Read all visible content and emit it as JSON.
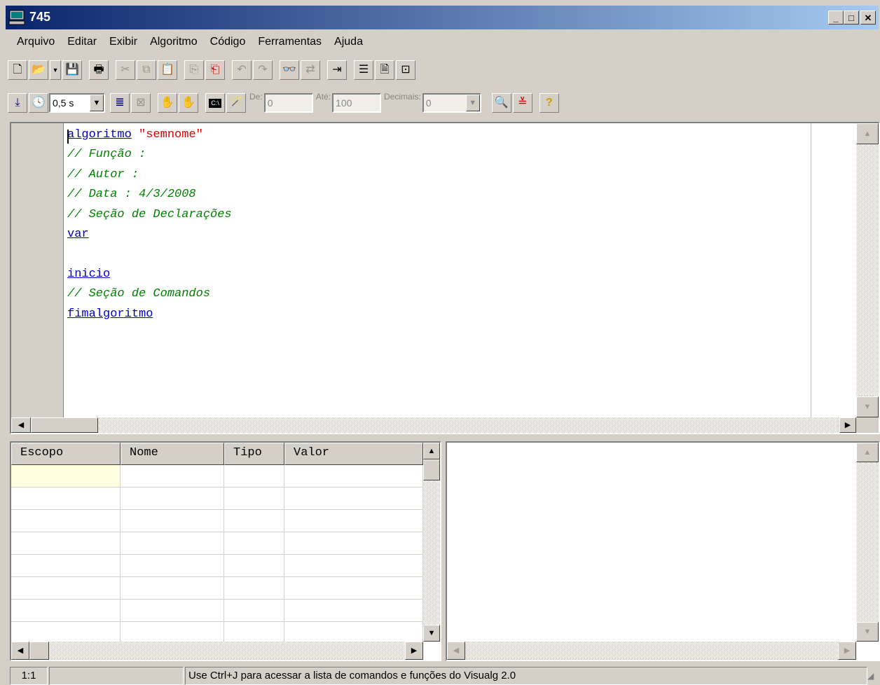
{
  "window": {
    "title": "745"
  },
  "menu": [
    "Arquivo",
    "Editar",
    "Exibir",
    "Algoritmo",
    "Código",
    "Ferramentas",
    "Ajuda"
  ],
  "toolbar2": {
    "speed_value": "0,5 s",
    "de_label": "De:",
    "de_value": "0",
    "ate_label": "Até:",
    "ate_value": "100",
    "decimais_label": "Decimais:",
    "decimais_value": "0"
  },
  "editor": {
    "lines": [
      [
        {
          "t": "algoritmo",
          "c": "kw"
        },
        {
          "t": " "
        },
        {
          "t": "\"semnome\"",
          "c": "str"
        }
      ],
      [
        {
          "t": "// Função :",
          "c": "cm"
        }
      ],
      [
        {
          "t": "// Autor :",
          "c": "cm"
        }
      ],
      [
        {
          "t": "// Data : 4/3/2008",
          "c": "cm"
        }
      ],
      [
        {
          "t": "// Seção de Declarações",
          "c": "cm"
        }
      ],
      [
        {
          "t": "var",
          "c": "kw"
        }
      ],
      [],
      [
        {
          "t": "inicio",
          "c": "kw"
        }
      ],
      [
        {
          "t": "// Seção de Comandos",
          "c": "cm"
        }
      ],
      [
        {
          "t": "fimalgoritmo",
          "c": "kw"
        }
      ]
    ]
  },
  "variables": {
    "columns": [
      "Escopo",
      "Nome",
      "Tipo",
      "Valor"
    ],
    "row_count": 8
  },
  "status": {
    "position": "1:1",
    "middle": "",
    "message": "Use Ctrl+J para acessar a lista de comandos e funções do Visualg 2.0"
  }
}
